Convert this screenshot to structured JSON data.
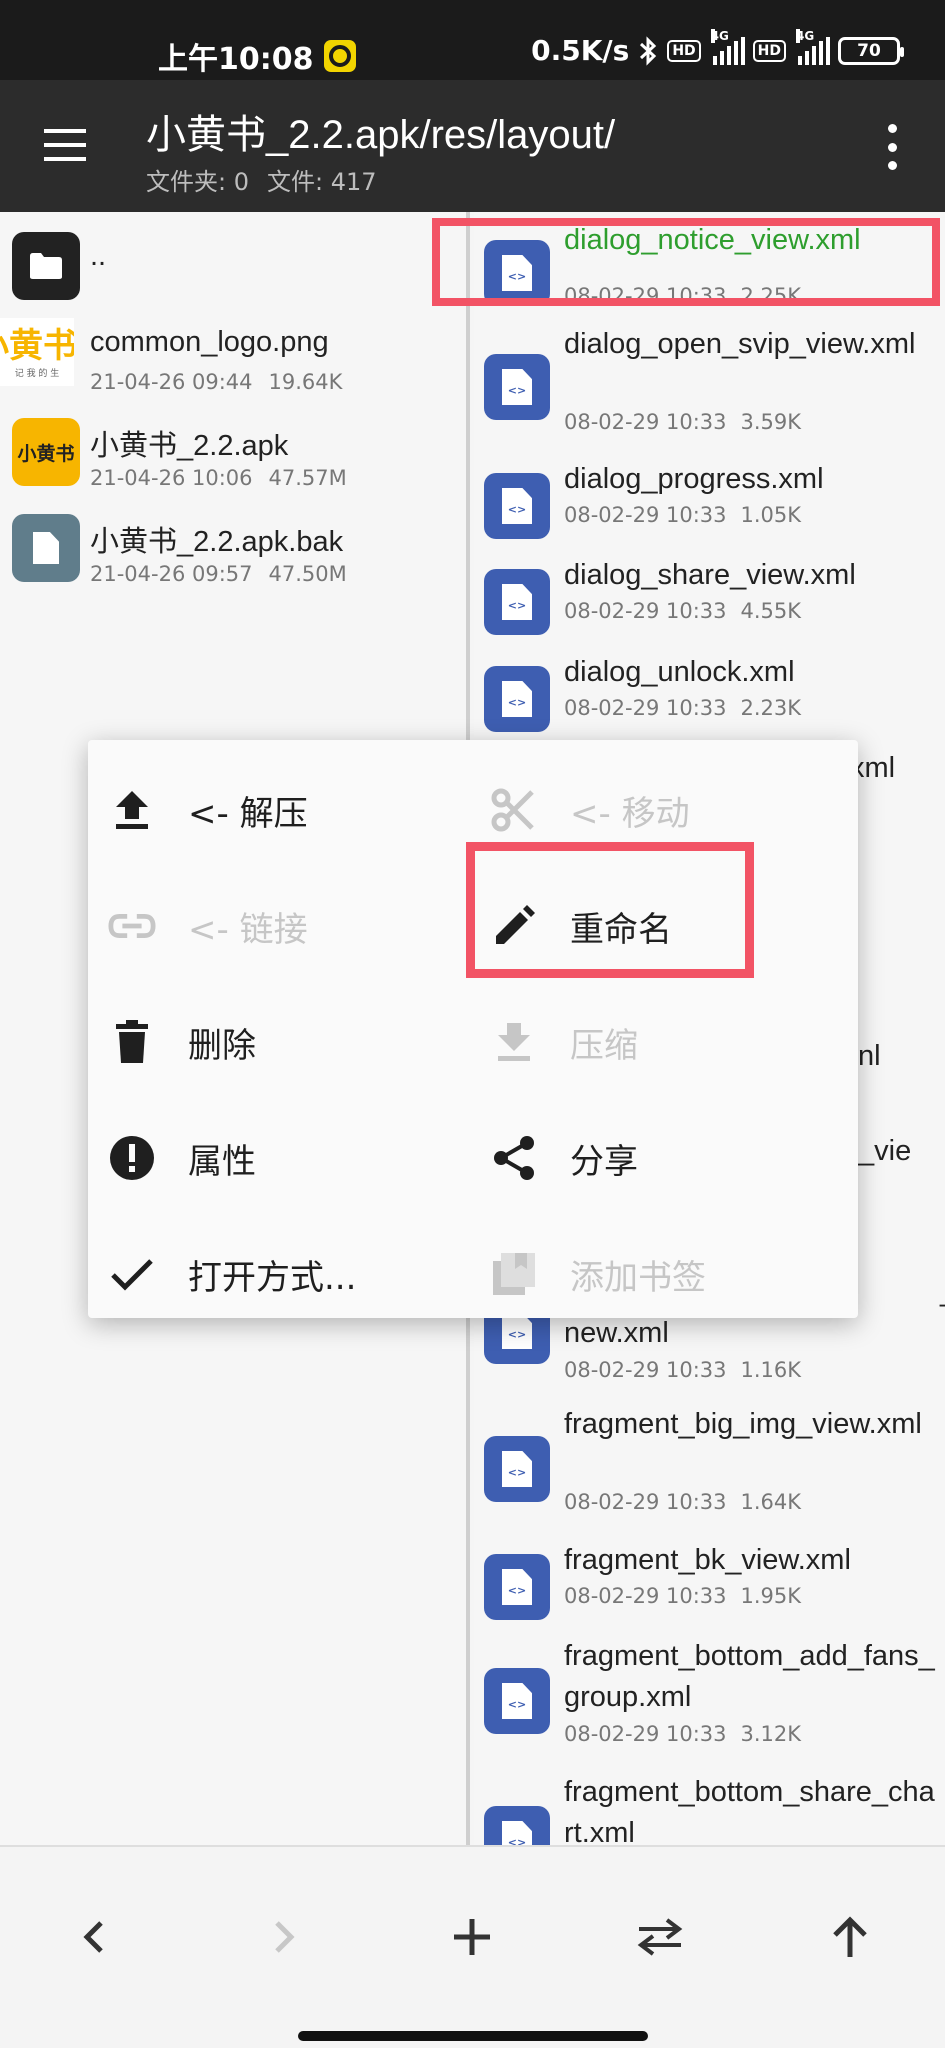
{
  "status_bar": {
    "time": "上午10:08",
    "speed": "0.5K/s",
    "hd1": "HD",
    "net1": "4G",
    "hd2": "HD",
    "net2": "4G",
    "battery": "70"
  },
  "app_bar": {
    "path": "小黄书_2.2.apk/res/layout/",
    "folders": "文件夹: 0",
    "files": "文件: 417"
  },
  "left_pane": {
    "items": [
      {
        "name": "..",
        "date": "",
        "size": "",
        "icon": "folder-icon"
      },
      {
        "name": "common_logo.png",
        "date": "21-04-26 09:44",
        "size": "19.64K",
        "icon": "image-thumbnail",
        "thumb_text": "小黄书",
        "thumb_sub": "记 我 的 生"
      },
      {
        "name": "小黄书_2.2.apk",
        "date": "21-04-26 10:06",
        "size": "47.57M",
        "icon": "apk-icon",
        "thumb_text": "小黄书"
      },
      {
        "name": "小黄书_2.2.apk.bak",
        "date": "21-04-26 09:57",
        "size": "47.50M",
        "icon": "file-icon"
      }
    ]
  },
  "right_pane": {
    "items": [
      {
        "name": "dialog_notice_view.xml",
        "date": "08-02-29 10:33",
        "size": "2.25K",
        "selected": true
      },
      {
        "name": "dialog_open_svip_view.xml",
        "date": "08-02-29 10:33",
        "size": "3.59K"
      },
      {
        "name": "dialog_progress.xml",
        "date": "08-02-29 10:33",
        "size": "1.05K"
      },
      {
        "name": "dialog_share_view.xml",
        "date": "08-02-29 10:33",
        "size": "4.55K"
      },
      {
        "name": "dialog_unlock.xml",
        "date": "08-02-29 10:33",
        "size": "2.23K"
      },
      {
        "name": "xml",
        "date": "",
        "size": ""
      },
      {
        "name": "nl",
        "date": "",
        "size": ""
      },
      {
        "name": "_vie",
        "date": "",
        "size": ""
      },
      {
        "name": "_new.xml",
        "date": "08-02-29 10:33",
        "size": "1.16K"
      },
      {
        "name": "fragment_big_img_view.xml",
        "date": "08-02-29 10:33",
        "size": "1.64K"
      },
      {
        "name": "fragment_bk_view.xml",
        "date": "08-02-29 10:33",
        "size": "1.95K"
      },
      {
        "name": "fragment_bottom_add_fans_group.xml",
        "date": "08-02-29 10:33",
        "size": "3.12K"
      },
      {
        "name": "fragment_bottom_share_chart.xml",
        "date": "",
        "size": ""
      }
    ]
  },
  "context_menu": {
    "items": [
      {
        "label": "<- 解压",
        "icon": "upload-icon",
        "enabled": true
      },
      {
        "label": "<- 移动",
        "icon": "scissors-icon",
        "enabled": false
      },
      {
        "label": "<- 链接",
        "icon": "link-icon",
        "enabled": false
      },
      {
        "label": "重命名",
        "icon": "pencil-icon",
        "enabled": true
      },
      {
        "label": "删除",
        "icon": "trash-icon",
        "enabled": true
      },
      {
        "label": "压缩",
        "icon": "download-icon",
        "enabled": false
      },
      {
        "label": "属性",
        "icon": "info-icon",
        "enabled": true
      },
      {
        "label": "分享",
        "icon": "share-icon",
        "enabled": true
      },
      {
        "label": "打开方式...",
        "icon": "check-icon",
        "enabled": true
      },
      {
        "label": "添加书签",
        "icon": "bookmark-icon",
        "enabled": false
      }
    ]
  },
  "colors": {
    "app_bar": "#2c2c2c",
    "selected_text": "#2e9e2e",
    "xml_icon": "#3e5eb1",
    "highlight": "#f25365",
    "brand_yellow": "#f7b500"
  }
}
